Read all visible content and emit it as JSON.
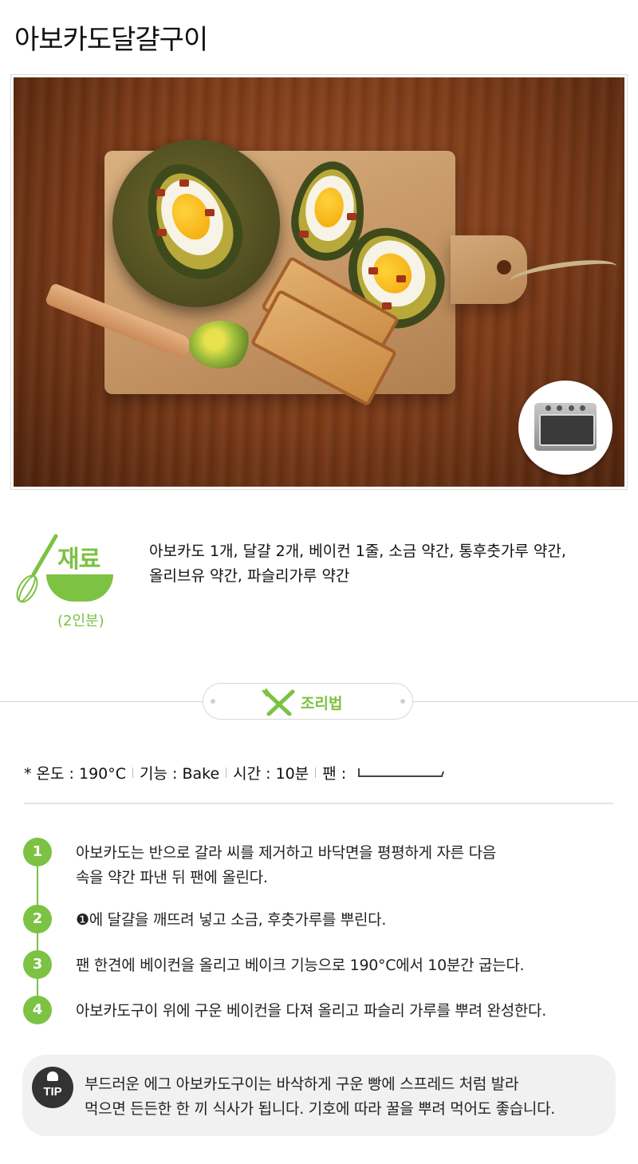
{
  "title": "아보카도달걀구이",
  "photo": {
    "description_icon": "oven-badge-icon"
  },
  "ingredients": {
    "label": "재료",
    "servings": "(2인분)",
    "line1": "아보카도 1개, 달걀 2개, 베이컨 1줄, 소금 약간, 통후춧가루 약간,",
    "line2": "올리브유 약간, 파슬리가루 약간"
  },
  "method": {
    "label": "조리법"
  },
  "settings": {
    "temp": "* 온도 : 190°C",
    "function": "기능 : Bake",
    "time": "시간 : 10분",
    "pan": "팬 :"
  },
  "steps": [
    {
      "num": "1",
      "line1": "아보카도는 반으로 갈라 씨를 제거하고 바닥면을 평평하게 자른 다음",
      "line2": "속을 약간 파낸 뒤 팬에 올린다."
    },
    {
      "num": "2",
      "line1": "❶에 달걀을 깨뜨려 넣고 소금, 후춧가루를 뿌린다.",
      "line2": ""
    },
    {
      "num": "3",
      "line1": "팬 한견에 베이컨을 올리고 베이크 기능으로 190°C에서 10분간 굽는다.",
      "line2": ""
    },
    {
      "num": "4",
      "line1": "아보카도구이 위에 구운 베이컨을 다져 올리고 파슬리 가루를 뿌려 완성한다.",
      "line2": ""
    }
  ],
  "tip": {
    "badge": "TIP",
    "line1": "부드러운 에그 아보카도구이는 바삭하게 구운 빵에 스프레드 처럼 발라",
    "line2": "먹으면 든든한 한 끼 식사가 됩니다. 기호에 따라 꿀을 뿌려 먹어도 좋습니다."
  },
  "colors": {
    "accent": "#7cc243",
    "tip_bg": "#f1f1f1"
  }
}
